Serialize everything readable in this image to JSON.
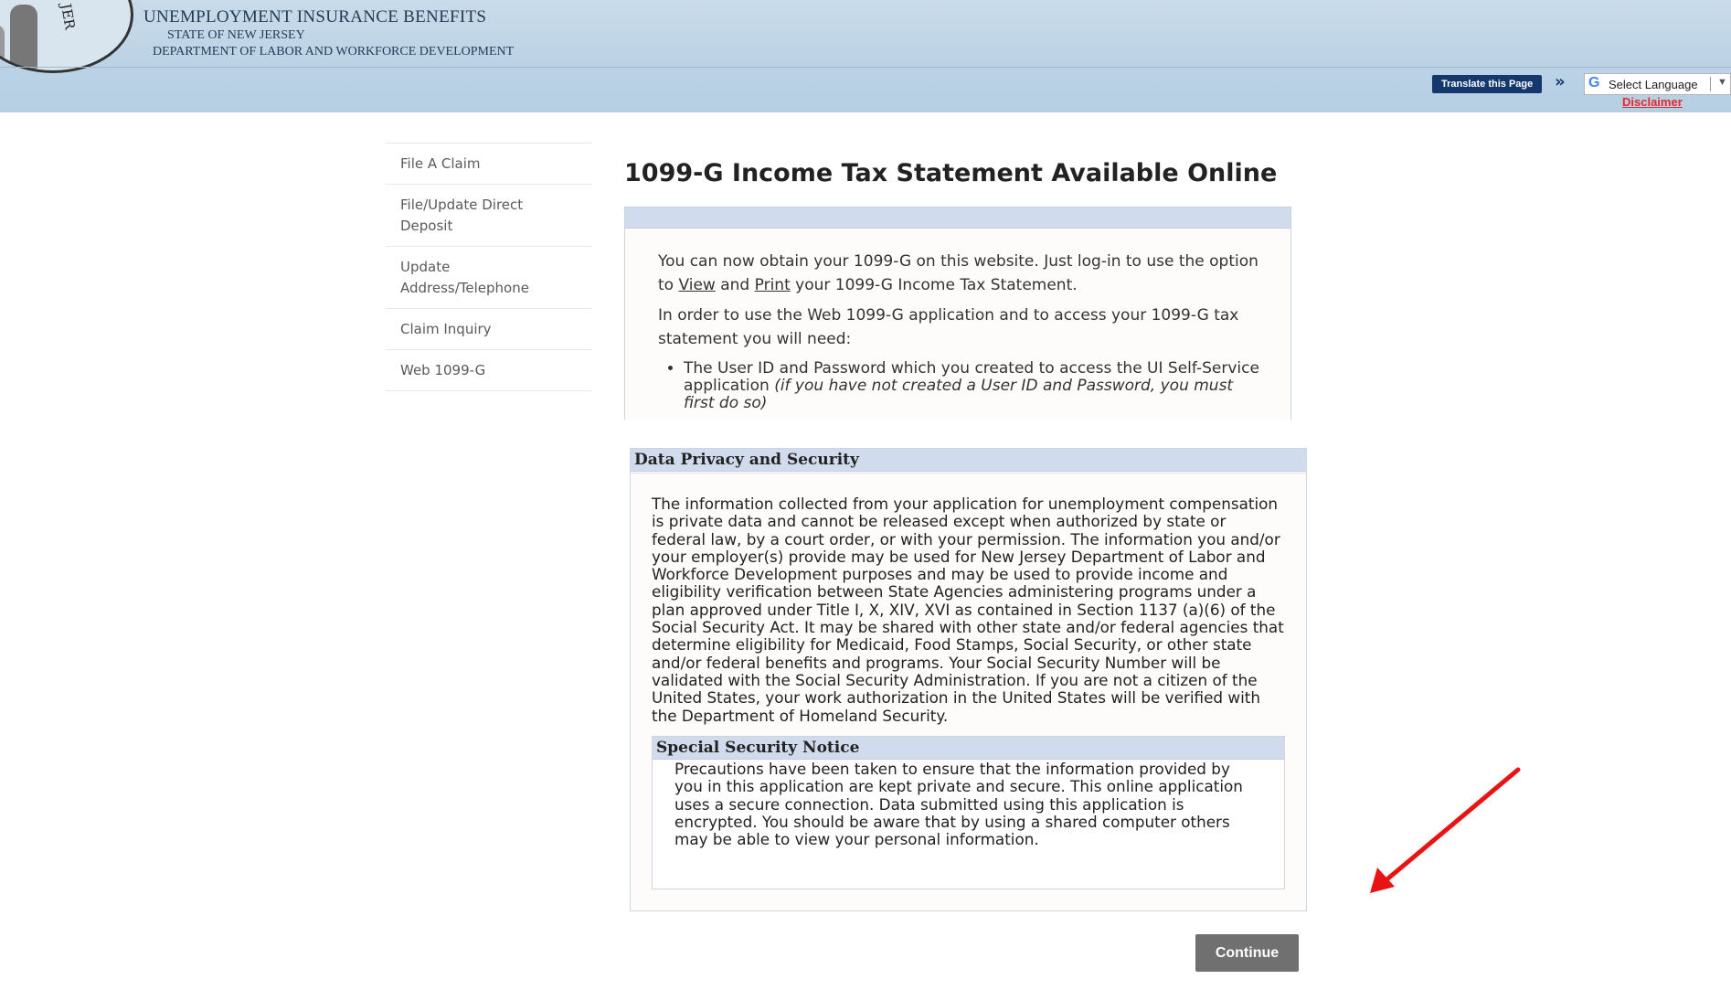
{
  "header": {
    "title": "UNEMPLOYMENT INSURANCE BENEFITS",
    "state": "STATE OF NEW JERSEY",
    "department": "DEPARTMENT OF LABOR AND WORKFORCE DEVELOPMENT",
    "seal_text": "NEW JER",
    "translate_label": "Translate this Page",
    "language_select": "Select Language",
    "disclaimer": "Disclaimer"
  },
  "sidebar": {
    "items": [
      {
        "label": "File A Claim"
      },
      {
        "label": "File/Update Direct Deposit"
      },
      {
        "label": "Update Address/Telephone"
      },
      {
        "label": "Claim Inquiry"
      },
      {
        "label": "Web 1099-G"
      }
    ]
  },
  "main": {
    "title": "1099-G Income Tax Statement Available Online",
    "intro": {
      "p1_a": "You can now obtain your 1099-G on this website. Just log-in to use the option to ",
      "view_link": "View",
      "p1_and": " and ",
      "print_link": "Print",
      "p1_b": " your 1099-G Income Tax Statement.",
      "p2": "In order to use the Web 1099-G application and to access your 1099-G tax statement you will need:",
      "bullet_a": "The User ID and Password which you created to access the UI Self-Service application ",
      "bullet_b": "(if you have not created a User ID and Password, you must first do so)"
    },
    "privacy": {
      "heading": "Data Privacy and Security",
      "text": "The information collected from your application for unemployment compensation is private data and cannot be released except when authorized by state or federal law, by a court order, or with your permission. The information you and/or your employer(s) provide may be used for New Jersey Department of Labor and Workforce Development purposes and may be used to provide income and eligibility verification between State Agencies administering programs under a plan approved under Title I, X, XIV, XVI as contained in Section 1137 (a)(6) of the Social Security Act. It may be shared with other state and/or federal agencies that determine eligibility for Medicaid, Food Stamps, Social Security, or other state and/or federal benefits and programs. Your Social Security Number will be validated with the Social Security Administration. If you are not a citizen of the United States, your work authorization in the United States will be verified with the Department of Homeland Security."
    },
    "notice": {
      "heading": "Special Security Notice",
      "text": "Precautions have been taken to ensure that the information provided by you in this application are kept private and secure. This online application uses a secure connection. Data submitted using this application is encrypted. You should be aware that by using a shared computer others may be able to view your personal information."
    },
    "continue_label": "Continue"
  },
  "colors": {
    "header_bg": "#bcd3e6",
    "box_header_bg": "#d0dced",
    "button_bg": "#707070",
    "disclaimer": "#e8262d",
    "annotation_arrow": "#e81414"
  },
  "icons": {
    "language": "google-g-icon",
    "dropdown": "chevron-down-icon",
    "annotation": "red-arrow-icon"
  }
}
